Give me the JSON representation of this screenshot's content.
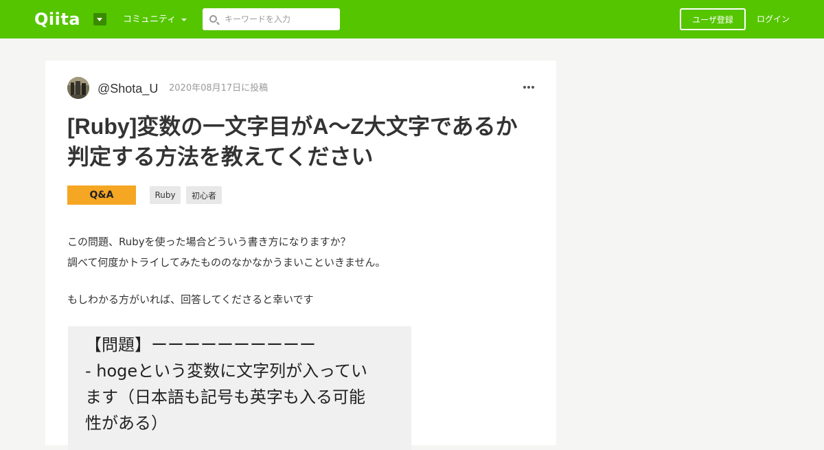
{
  "header": {
    "logo": "Qiita",
    "community_label": "コミュニティ",
    "search_placeholder": "キーワードを入力",
    "signup_label": "ユーザ登録",
    "login_label": "ログイン",
    "brand_color": "#55c500"
  },
  "article": {
    "author": "@Shota_U",
    "posted_at": "2020年08月17日に投稿",
    "title_line1": "[Ruby]変数の一文字目がA〜Z大文字であるか",
    "title_line2": "判定する方法を教えてください",
    "badge": "Q&A",
    "tags": [
      "Ruby",
      "初心者"
    ],
    "body": [
      "この問題、Rubyを使った場合どういう書き方になりますか？",
      "調べて何度かトライしてみたもののなかなかうまいこといきません。",
      "もしわかる方がいれば、回答してくださると幸いです"
    ],
    "problem_image_lines": [
      "【問題】ーーーーーーーーーー",
      "- hogeという変数に文字列が入ってい",
      "ます（日本語も記号も英字も入る可能",
      "性がある）"
    ]
  }
}
